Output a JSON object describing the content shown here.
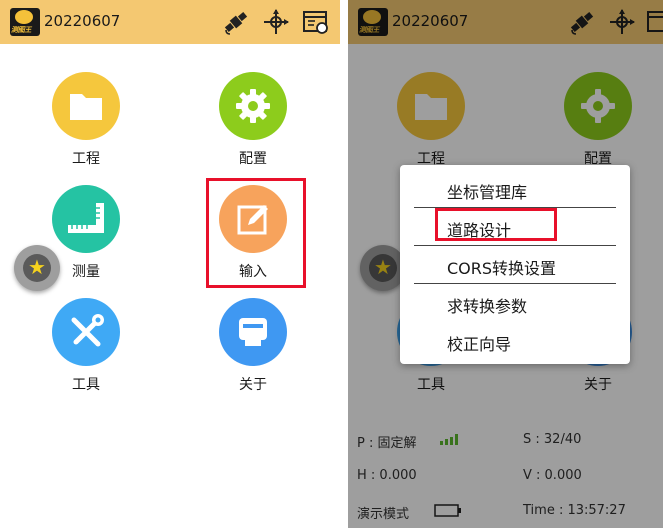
{
  "left_screen": {
    "topbar": {
      "title": "20220607",
      "logo_text": "测图王"
    },
    "tiles": [
      {
        "key": "project",
        "label": "工程",
        "color": "#f5c73d",
        "icon": "folder-icon"
      },
      {
        "key": "config",
        "label": "配置",
        "color": "#8dcc1c",
        "icon": "gear-icon"
      },
      {
        "key": "survey",
        "label": "测量",
        "color": "#25c3a3",
        "icon": "ruler-icon"
      },
      {
        "key": "input",
        "label": "输入",
        "color": "#f7a35c",
        "icon": "edit-icon"
      },
      {
        "key": "tools",
        "label": "工具",
        "color": "#3fa9f5",
        "icon": "tools-icon"
      },
      {
        "key": "about",
        "label": "关于",
        "color": "#3f98f2",
        "icon": "device-icon"
      }
    ],
    "highlight": "输入"
  },
  "right_screen": {
    "topbar": {
      "title": "20220607",
      "logo_text": "测图王"
    },
    "popup_menu": {
      "items": [
        {
          "label": "坐标管理库"
        },
        {
          "label": "道路设计"
        },
        {
          "label": "CORS转换设置"
        },
        {
          "label": "求转换参数"
        },
        {
          "label": "校正向导"
        }
      ],
      "highlight": "道路设计"
    },
    "status": {
      "position_label": "P : 固定解",
      "satellites": "S : 32/40",
      "h_value": "H : 0.000",
      "v_value": "V : 0.000",
      "mode": "演示模式",
      "time": "Time :  13:57:27"
    }
  },
  "colors": {
    "topbar": "#f4c871",
    "highlight": "#e8102a",
    "signal": "#5cb82e"
  }
}
